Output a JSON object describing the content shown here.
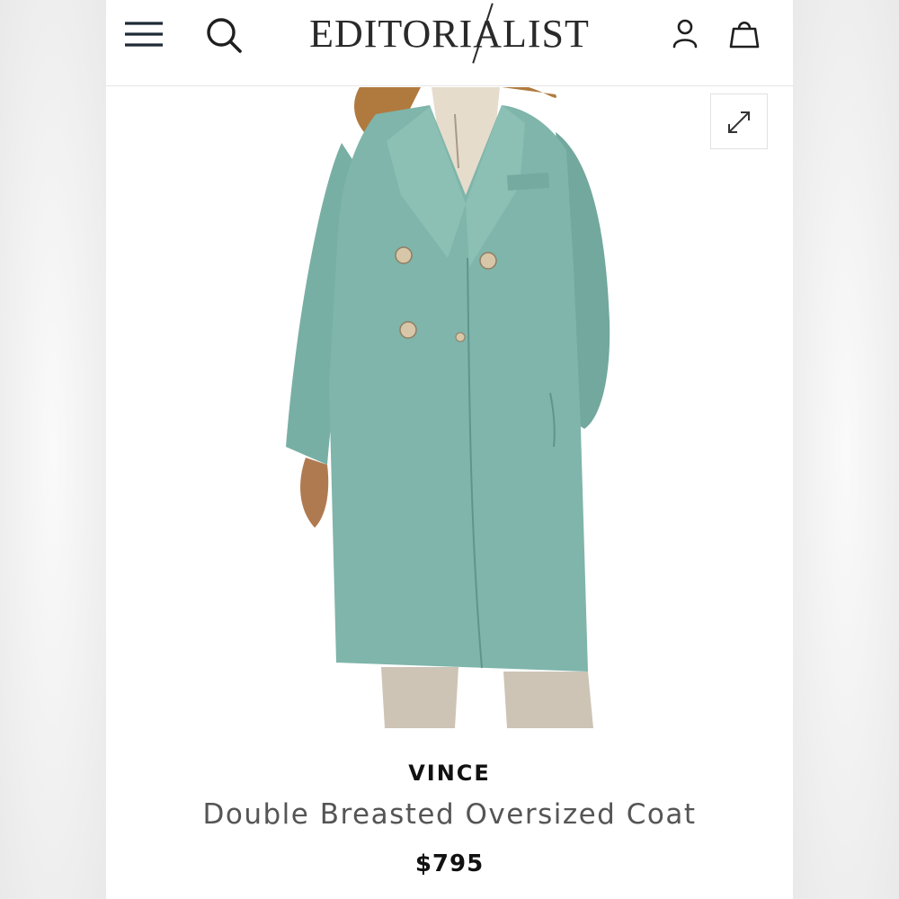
{
  "header": {
    "logo_text": "EDITORIALIST",
    "menu_icon": "hamburger-menu-icon",
    "search_icon": "search-icon",
    "account_icon": "user-account-icon",
    "bag_icon": "shopping-bag-icon"
  },
  "gallery": {
    "expand_icon": "expand-arrows-icon"
  },
  "product": {
    "brand": "VINCE",
    "name": "Double Breasted Oversized Coat",
    "price": "$795",
    "coat_color": "#7fb5ab"
  },
  "colors": {
    "text_primary": "#111111",
    "text_secondary": "#555555",
    "background": "#ffffff"
  }
}
